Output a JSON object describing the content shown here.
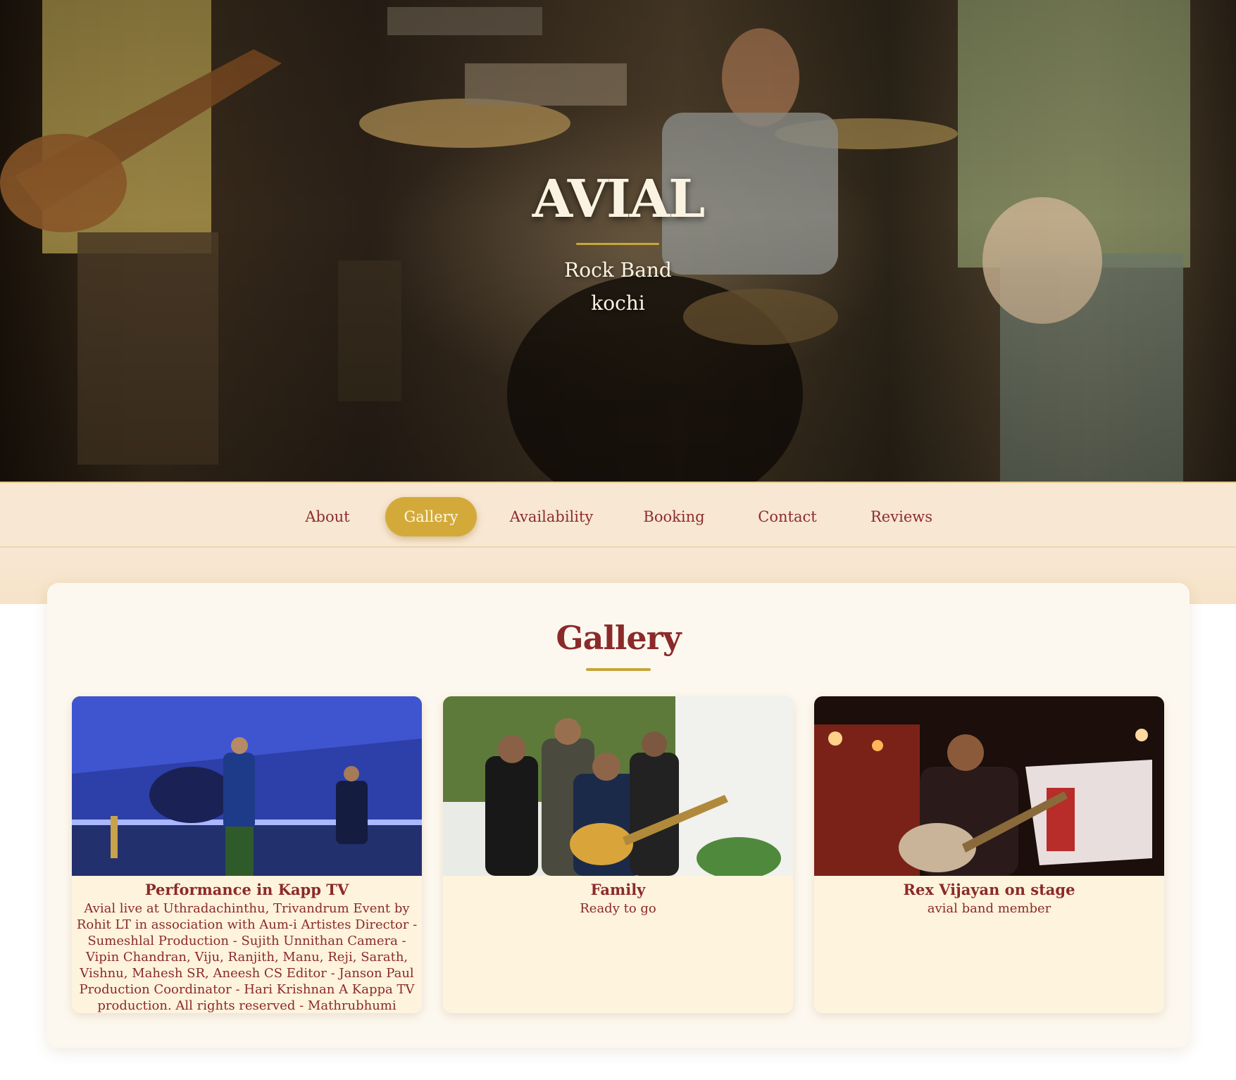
{
  "hero": {
    "title": "AVIAL",
    "genre": "Rock Band",
    "city": "kochi"
  },
  "nav": {
    "items": [
      {
        "label": "About",
        "active": false
      },
      {
        "label": "Gallery",
        "active": true
      },
      {
        "label": "Availability",
        "active": false
      },
      {
        "label": "Booking",
        "active": false
      },
      {
        "label": "Contact",
        "active": false
      },
      {
        "label": "Reviews",
        "active": false
      }
    ]
  },
  "gallery": {
    "heading": "Gallery",
    "items": [
      {
        "title": "Performance in Kapp TV",
        "description": "Avial live at Uthradachinthu, Trivandrum Event by Rohit LT in association with Aum-i Artistes Director - Sumeshlal Production - Sujith Unnithan Camera - Vipin Chandran, Viju, Ranjith, Manu, Reji, Sarath, Vishnu, Mahesh SR, Aneesh CS Editor - Janson Paul Production Coordinator - Hari Krishnan A Kappa TV production. All rights reserved - Mathrubhumi"
      },
      {
        "title": "Family",
        "description": "Ready to go"
      },
      {
        "title": "Rex Vijayan on stage",
        "description": "avial band member"
      }
    ]
  },
  "colors": {
    "accent": "#d3aa3a",
    "text_dark_red": "#8b2a2a",
    "nav_bg": "#f8e7d3",
    "panel_bg": "#fdf8ef",
    "card_bg": "#fef3dc"
  }
}
